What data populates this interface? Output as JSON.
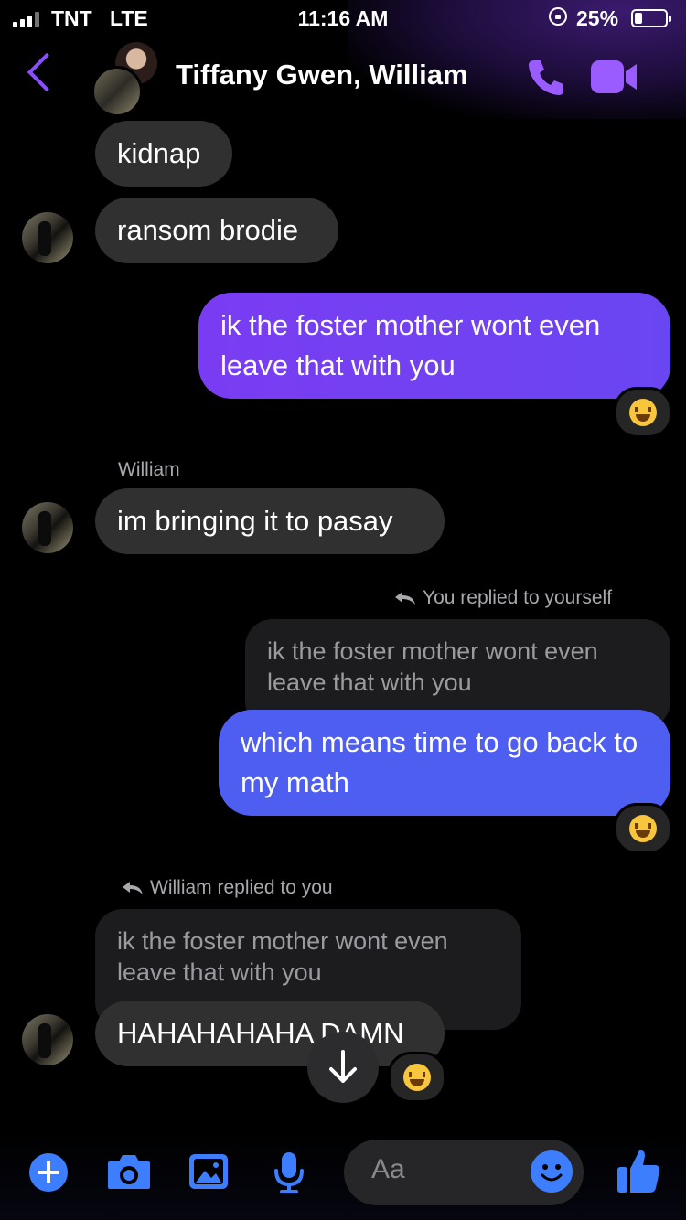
{
  "status_bar": {
    "carrier": "TNT",
    "network": "LTE",
    "time": "11:16 AM",
    "battery": "25%"
  },
  "header": {
    "title": "Tiffany Gwen, William",
    "accent_color": "#8a4dff"
  },
  "messages": [
    {
      "text": "kidnap"
    },
    {
      "text": "ransom brodie"
    },
    {
      "text": "ik the foster mother wont even leave that with you",
      "reaction": "laughing-emoji"
    },
    {
      "sender": "William",
      "text": "im bringing it to pasay"
    },
    {
      "reply_note": "You replied to yourself",
      "quote": "ik the foster mother wont even leave that with you",
      "text": "which means time to go back to my math",
      "reaction": "laughing-emoji"
    },
    {
      "reply_note": "William replied to you",
      "quote": "ik the foster mother wont even leave that with you",
      "text": "HAHAHAHAHA DAMN",
      "reaction": "laughing-emoji"
    }
  ],
  "composer": {
    "placeholder": "Aa"
  },
  "colors": {
    "incoming_bubble": "#303030",
    "outgoing_bubble_1": "#7a3cf2",
    "outgoing_bubble_2": "#4e5ef0",
    "action_blue": "#3d7eff"
  }
}
